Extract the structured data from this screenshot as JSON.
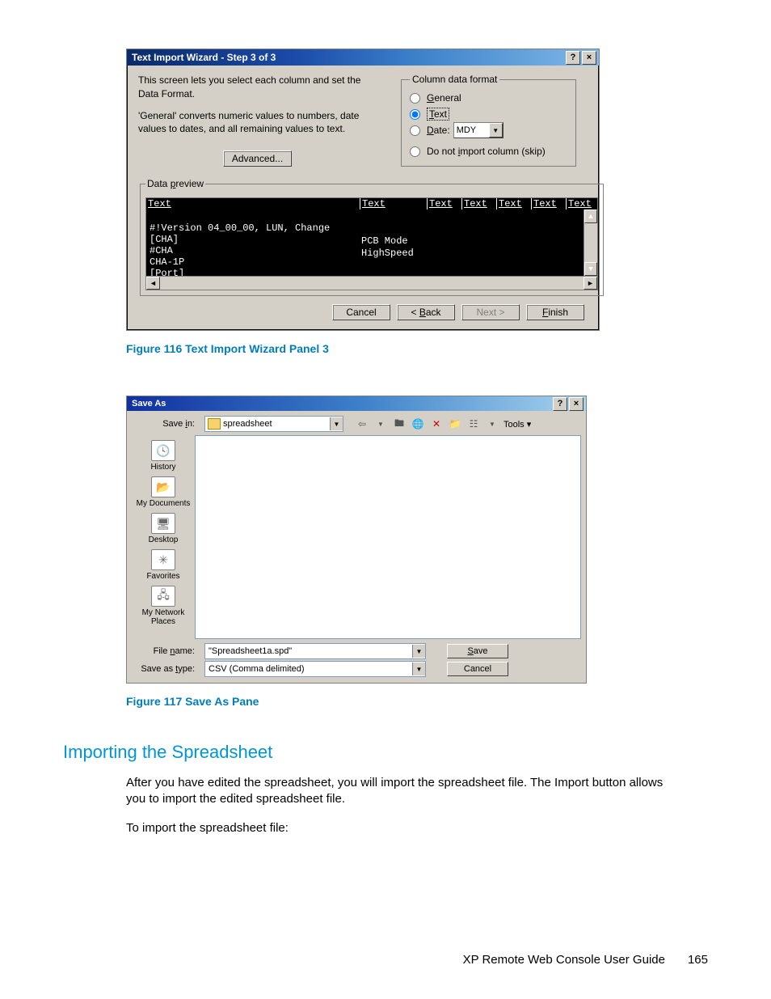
{
  "dlg1": {
    "title": "Text Import Wizard - Step 3 of 3",
    "desc1": "This screen lets you select each column and set the Data Format.",
    "desc2": "'General' converts numeric values to numbers, date values to dates, and all remaining values to text.",
    "advanced": "Advanced...",
    "group_label": "Column data format",
    "opt_general": "General",
    "opt_text": "Text",
    "opt_date": "Date:",
    "date_value": "MDY",
    "opt_skip": "Do not import column (skip)",
    "preview_label": "Data preview",
    "headers": [
      "Text",
      "Text",
      "Text",
      "Text",
      "Text",
      "Text",
      "Text"
    ],
    "rows_col1": [
      "#!Version 04_00_00, LUN, Change",
      "[CHA]",
      "#CHA",
      "CHA-1P",
      "[Port]"
    ],
    "rows_col2": [
      "",
      "",
      "PCB Mode",
      "HighSpeed",
      ""
    ],
    "btn_cancel": "Cancel",
    "btn_back": "< Back",
    "btn_next": "Next >",
    "btn_finish": "Finish"
  },
  "fig1": "Figure 116 Text Import Wizard Panel 3",
  "dlg2": {
    "title": "Save As",
    "savein_label": "Save in:",
    "savein_value": "spreadsheet",
    "tools": "Tools",
    "places": [
      "History",
      "My Documents",
      "Desktop",
      "Favorites",
      "My Network Places"
    ],
    "filename_label": "File name:",
    "filename_value": "\"Spreadsheet1a.spd\"",
    "type_label": "Save as type:",
    "type_value": "CSV (Comma delimited)",
    "btn_save": "Save",
    "btn_cancel": "Cancel"
  },
  "fig2": "Figure 117 Save As Pane",
  "section_heading": "Importing the Spreadsheet",
  "para1": "After you have edited the spreadsheet, you will import the spreadsheet file. The Import button allows you to import the edited spreadsheet file.",
  "para2": "To import the spreadsheet file:",
  "footer_text": "XP Remote Web Console User Guide",
  "page_number": "165"
}
